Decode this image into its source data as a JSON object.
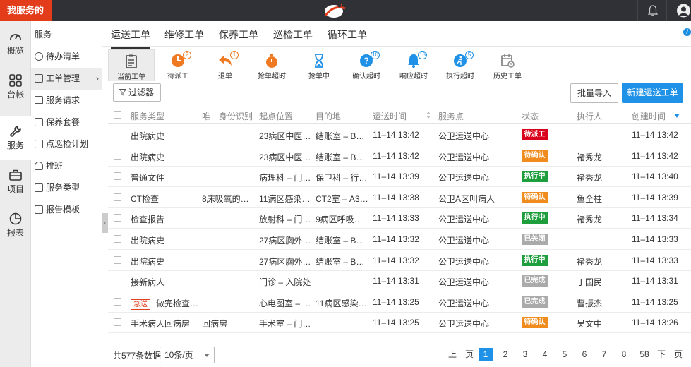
{
  "brand": "我服务的",
  "rail": [
    {
      "label": "概览",
      "icon": "gauge-icon"
    },
    {
      "label": "台帐",
      "icon": "grid-icon"
    },
    {
      "label": "服务",
      "icon": "wrench-icon"
    },
    {
      "label": "项目",
      "icon": "briefcase-icon"
    },
    {
      "label": "报表",
      "icon": "pie-chart-icon"
    }
  ],
  "submenu": {
    "title": "服务",
    "items": [
      {
        "label": "待办清单"
      },
      {
        "label": "工单管理"
      },
      {
        "label": "服务请求"
      },
      {
        "label": "保养套餐"
      },
      {
        "label": "点巡检计划"
      },
      {
        "label": "排班"
      },
      {
        "label": "服务类型"
      },
      {
        "label": "报告模板"
      }
    ]
  },
  "tabs": [
    "运送工单",
    "维修工单",
    "保养工单",
    "巡检工单",
    "循环工单"
  ],
  "subtabs": [
    {
      "label": "当前工单",
      "badge": "",
      "color": "#555555"
    },
    {
      "label": "待派工",
      "badge": "2",
      "color": "#f07a22"
    },
    {
      "label": "退单",
      "badge": "1",
      "color": "#f07a22"
    },
    {
      "label": "抢单超时",
      "badge": "",
      "color": "#f07a22"
    },
    {
      "label": "抢单中",
      "badge": "",
      "color": "#1f91e6"
    },
    {
      "label": "确认超时",
      "badge": "10",
      "color": "#1f91e6"
    },
    {
      "label": "响应超时",
      "badge": "18",
      "color": "#1f91e6"
    },
    {
      "label": "执行超时",
      "badge": "5",
      "color": "#1f91e6"
    },
    {
      "label": "历史工单",
      "badge": "",
      "color": "#888888"
    }
  ],
  "toolbar": {
    "filter": "过滤器",
    "import": "批量导入",
    "new": "新建运送工单"
  },
  "table": {
    "headers": [
      "服务类型",
      "唯一身份识别",
      "起点位置",
      "目的地",
      "运送时间",
      "服务点",
      "状态",
      "执行人",
      "创建时间"
    ],
    "rows": [
      {
        "type": "出院病史",
        "urgent": "",
        "uid": "",
        "start": "23病区中医…",
        "dest": "结账室 – B…",
        "time": "11–14 13:42",
        "point": "公卫运送中心",
        "status": "待派工",
        "status_color": "#d9001b",
        "executor": "",
        "created": "11–14 13:42"
      },
      {
        "type": "出院病史",
        "urgent": "",
        "uid": "",
        "start": "23病区中医…",
        "dest": "结账室 – B…",
        "time": "11–14 13:42",
        "point": "公卫运送中心",
        "status": "待确认",
        "status_color": "#f08c1e",
        "executor": "褚秀龙",
        "created": "11–14 13:42"
      },
      {
        "type": "普通文件",
        "urgent": "",
        "uid": "",
        "start": "病理科 – 门…",
        "dest": "保卫科 – 行…",
        "time": "11–14 13:39",
        "point": "公卫运送中心",
        "status": "执行中",
        "status_color": "#1e9e3c",
        "executor": "褚秀龙",
        "created": "11–14 13:40"
      },
      {
        "type": "CT检查",
        "urgent": "",
        "uid": "8床吸氧的…",
        "start": "11病区感染…",
        "dest": "CT2室 – A3…",
        "time": "11–14 13:38",
        "point": "公卫A区叫病人",
        "status": "待确认",
        "status_color": "#f08c1e",
        "executor": "鱼全柱",
        "created": "11–14 13:39"
      },
      {
        "type": "检查报告",
        "urgent": "",
        "uid": "",
        "start": "放射科 – 门…",
        "dest": "9病区呼吸…",
        "time": "11–14 13:33",
        "point": "公卫运送中心",
        "status": "执行中",
        "status_color": "#1e9e3c",
        "executor": "褚秀龙",
        "created": "11–14 13:34"
      },
      {
        "type": "出院病史",
        "urgent": "",
        "uid": "",
        "start": "27病区胸外…",
        "dest": "结账室 – B…",
        "time": "11–14 13:32",
        "point": "公卫运送中心",
        "status": "已关闭",
        "status_color": "#aaaaaa",
        "executor": "",
        "created": "11–14 13:33"
      },
      {
        "type": "出院病史",
        "urgent": "",
        "uid": "",
        "start": "27病区胸外…",
        "dest": "结账室 – B…",
        "time": "11–14 13:32",
        "point": "公卫运送中心",
        "status": "执行中",
        "status_color": "#1e9e3c",
        "executor": "褚秀龙",
        "created": "11–14 13:33"
      },
      {
        "type": "接新病人",
        "urgent": "",
        "uid": "",
        "start": "门诊 – 入院处",
        "dest": "",
        "time": "11–14 13:31",
        "point": "公卫运送中心",
        "status": "已完成",
        "status_color": "#aaaaaa",
        "executor": "丁国民",
        "created": "11–14 13:31"
      },
      {
        "type": "做完检查…",
        "urgent": "急送",
        "uid": "",
        "start": "心电图室 – …",
        "dest": "11病区感染…",
        "time": "11–14 13:25",
        "point": "公卫运送中心",
        "status": "已完成",
        "status_color": "#aaaaaa",
        "executor": "曹振杰",
        "created": "11–14 13:25"
      },
      {
        "type": "手术病人回病房",
        "urgent": "",
        "uid": "回病房",
        "start": "手术室 – 门…",
        "dest": "",
        "time": "11–14 13:25",
        "point": "公卫运送中心",
        "status": "待确认",
        "status_color": "#f08c1e",
        "executor": "吴文中",
        "created": "11–14 13:26"
      }
    ]
  },
  "footer": {
    "total": "共577条数据",
    "pagesize": "10条/页",
    "prev": "上一页",
    "pages": [
      "1",
      "2",
      "3",
      "4",
      "5",
      "6",
      "7",
      "8",
      "58"
    ],
    "current": "1",
    "next": "下一页"
  }
}
